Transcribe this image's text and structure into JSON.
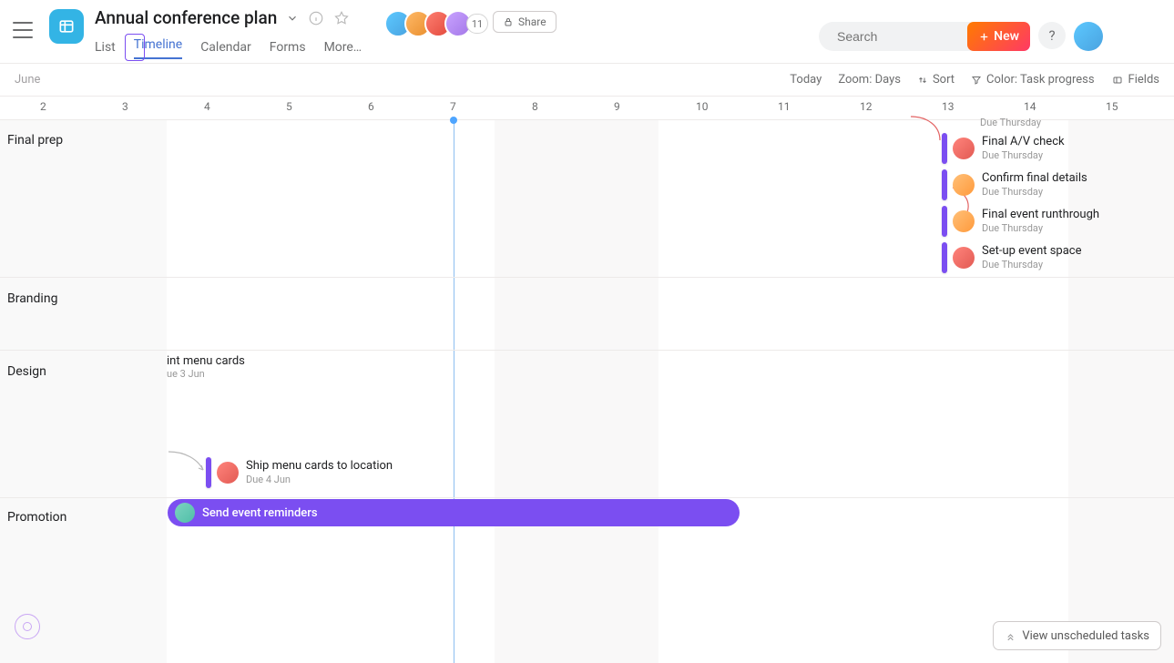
{
  "header": {
    "title": "Annual conference plan",
    "share_label": "Share",
    "member_overflow": "11",
    "search_placeholder": "Search",
    "new_label": "New",
    "help_label": "?"
  },
  "tabs": [
    {
      "label": "List"
    },
    {
      "label": "Timeline",
      "active": true
    },
    {
      "label": "Calendar"
    },
    {
      "label": "Forms"
    },
    {
      "label": "More…"
    }
  ],
  "toolbar": {
    "month": "June",
    "today": "Today",
    "zoom": "Zoom: Days",
    "sort": "Sort",
    "color": "Color: Task progress",
    "fields": "Fields"
  },
  "dates": [
    "2",
    "3",
    "4",
    "5",
    "6",
    "7",
    "8",
    "9",
    "10",
    "11",
    "12",
    "13",
    "14",
    "15"
  ],
  "sections": {
    "final_prep": "Final prep",
    "branding": "Branding",
    "design": "Design",
    "promotion": "Promotion"
  },
  "tasks": {
    "partial_due_cut": "Due Thursday",
    "final_av": {
      "name": "Final A/V check",
      "due": "Due Thursday"
    },
    "confirm": {
      "name": "Confirm final details",
      "due": "Due Thursday"
    },
    "runthrough": {
      "name": "Final event runthrough",
      "due": "Due Thursday"
    },
    "setup": {
      "name": "Set-up event space",
      "due": "Due Thursday"
    },
    "print_menu": {
      "name_partial": "int menu cards",
      "due_partial": "ue 3 Jun"
    },
    "ship_menu": {
      "name": "Ship menu cards to location",
      "due": "Due 4 Jun"
    },
    "send_reminders": {
      "name": "Send event reminders"
    }
  },
  "footer": {
    "unscheduled_label": "View unscheduled tasks"
  },
  "colors": {
    "accent_purple": "#7b4ef1",
    "header_icon": "#33b4e5"
  }
}
